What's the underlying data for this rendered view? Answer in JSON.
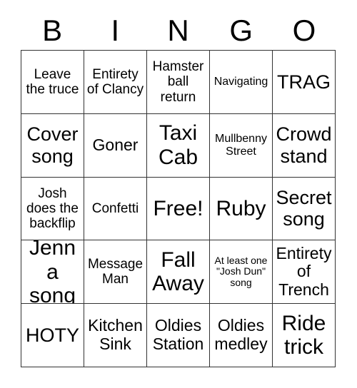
{
  "card": {
    "header_letters": [
      "B",
      "I",
      "N",
      "G",
      "O"
    ],
    "columns": 5,
    "rows": 5,
    "border_color": "#333333",
    "text_color": "#000000",
    "background_color": "#ffffff",
    "cells": [
      {
        "text": "Leave the truce",
        "size": "md"
      },
      {
        "text": "Entirety of Clancy",
        "size": "md"
      },
      {
        "text": "Hamster ball return",
        "size": "md"
      },
      {
        "text": "Navigating",
        "size": "sm"
      },
      {
        "text": "TRAG",
        "size": "xl"
      },
      {
        "text": "Cover song",
        "size": "xl"
      },
      {
        "text": "Goner",
        "size": "lg"
      },
      {
        "text": "Taxi Cab",
        "size": "xxl"
      },
      {
        "text": "Mullbenny Street",
        "size": "sm"
      },
      {
        "text": "Crowd stand",
        "size": "xl"
      },
      {
        "text": "Josh does the backflip",
        "size": "md"
      },
      {
        "text": "Confetti",
        "size": "md"
      },
      {
        "text": "Free!",
        "size": "xxl"
      },
      {
        "text": "Ruby",
        "size": "xxl"
      },
      {
        "text": "Secret song",
        "size": "xl"
      },
      {
        "text": "Jenna song",
        "size": "xxl"
      },
      {
        "text": "Message Man",
        "size": "md"
      },
      {
        "text": "Fall Away",
        "size": "xxl"
      },
      {
        "text": "At least one \"Josh Dun\" song",
        "size": "xs"
      },
      {
        "text": "Entirety of Trench",
        "size": "lg"
      },
      {
        "text": "HOTY",
        "size": "xl"
      },
      {
        "text": "Kitchen Sink",
        "size": "lg"
      },
      {
        "text": "Oldies Station",
        "size": "lg"
      },
      {
        "text": "Oldies medley",
        "size": "lg"
      },
      {
        "text": "Ride trick",
        "size": "xxl"
      }
    ]
  }
}
